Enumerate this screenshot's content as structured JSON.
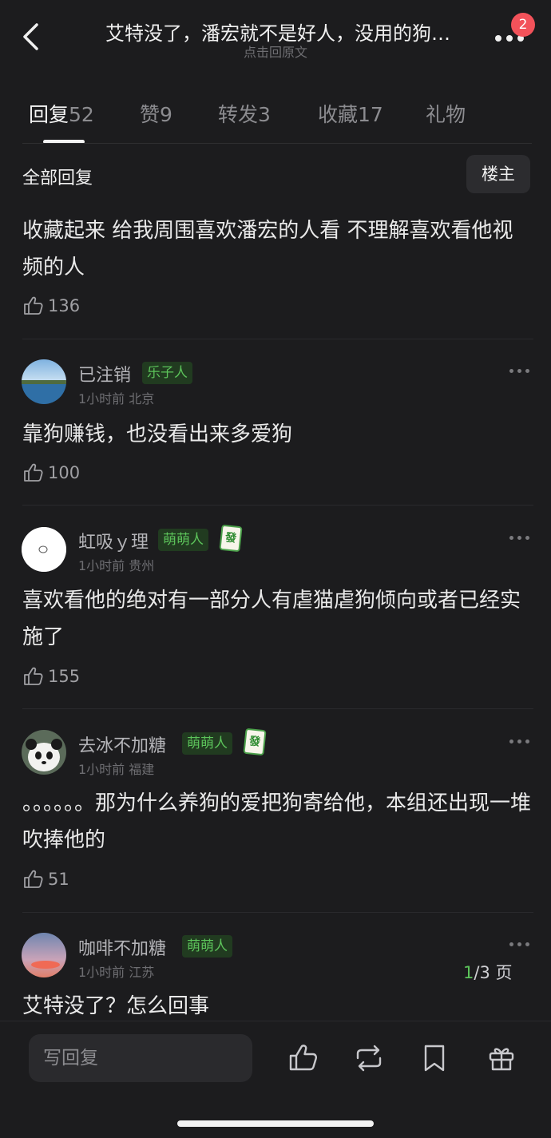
{
  "header": {
    "title": "艾特没了，潘宏就不是好人，没用的狗…",
    "subtitle": "点击回原文",
    "notification_count": "2"
  },
  "tabs": [
    {
      "label": "回复",
      "count": "52"
    },
    {
      "label": "赞",
      "count": "9"
    },
    {
      "label": "转发",
      "count": "3"
    },
    {
      "label": "收藏",
      "count": "17"
    },
    {
      "label": "礼物",
      "count": ""
    }
  ],
  "section": {
    "title": "全部回复",
    "filter": "楼主"
  },
  "comments": [
    {
      "text": "收藏起来 给我周围喜欢潘宏的人看 不理解喜欢看他视频的人",
      "likes": "136"
    },
    {
      "username": "已注销",
      "tag": "乐子人",
      "time": "1小时前",
      "location": "北京",
      "text": "靠狗赚钱，也没看出来多爱狗",
      "likes": "100"
    },
    {
      "username": "虹吸ｙ理",
      "tag": "萌萌人",
      "mahjong": "發",
      "time": "1小时前",
      "location": "贵州",
      "text": "喜欢看他的绝对有一部分人有虐猫虐狗倾向或者已经实施了",
      "likes": "155"
    },
    {
      "username": "去冰不加糖",
      "tag": "萌萌人",
      "mahjong": "發",
      "time": "1小时前",
      "location": "福建",
      "text": "。。。。。。那为什么养狗的爱把狗寄给他，本组还出现一堆吹捧他的",
      "likes": "51"
    },
    {
      "username": "咖啡不加糖",
      "tag": "萌萌人",
      "time": "1小时前",
      "location": "江苏",
      "text": "艾特没了？怎么回事"
    }
  ],
  "pagination": {
    "current": "1",
    "total": "/3 页"
  },
  "bottom_bar": {
    "reply_placeholder": "写回复"
  },
  "colors": {
    "background": "#1c1c1e",
    "accent_green": "#5cc35a",
    "badge_red": "#f2525a"
  }
}
